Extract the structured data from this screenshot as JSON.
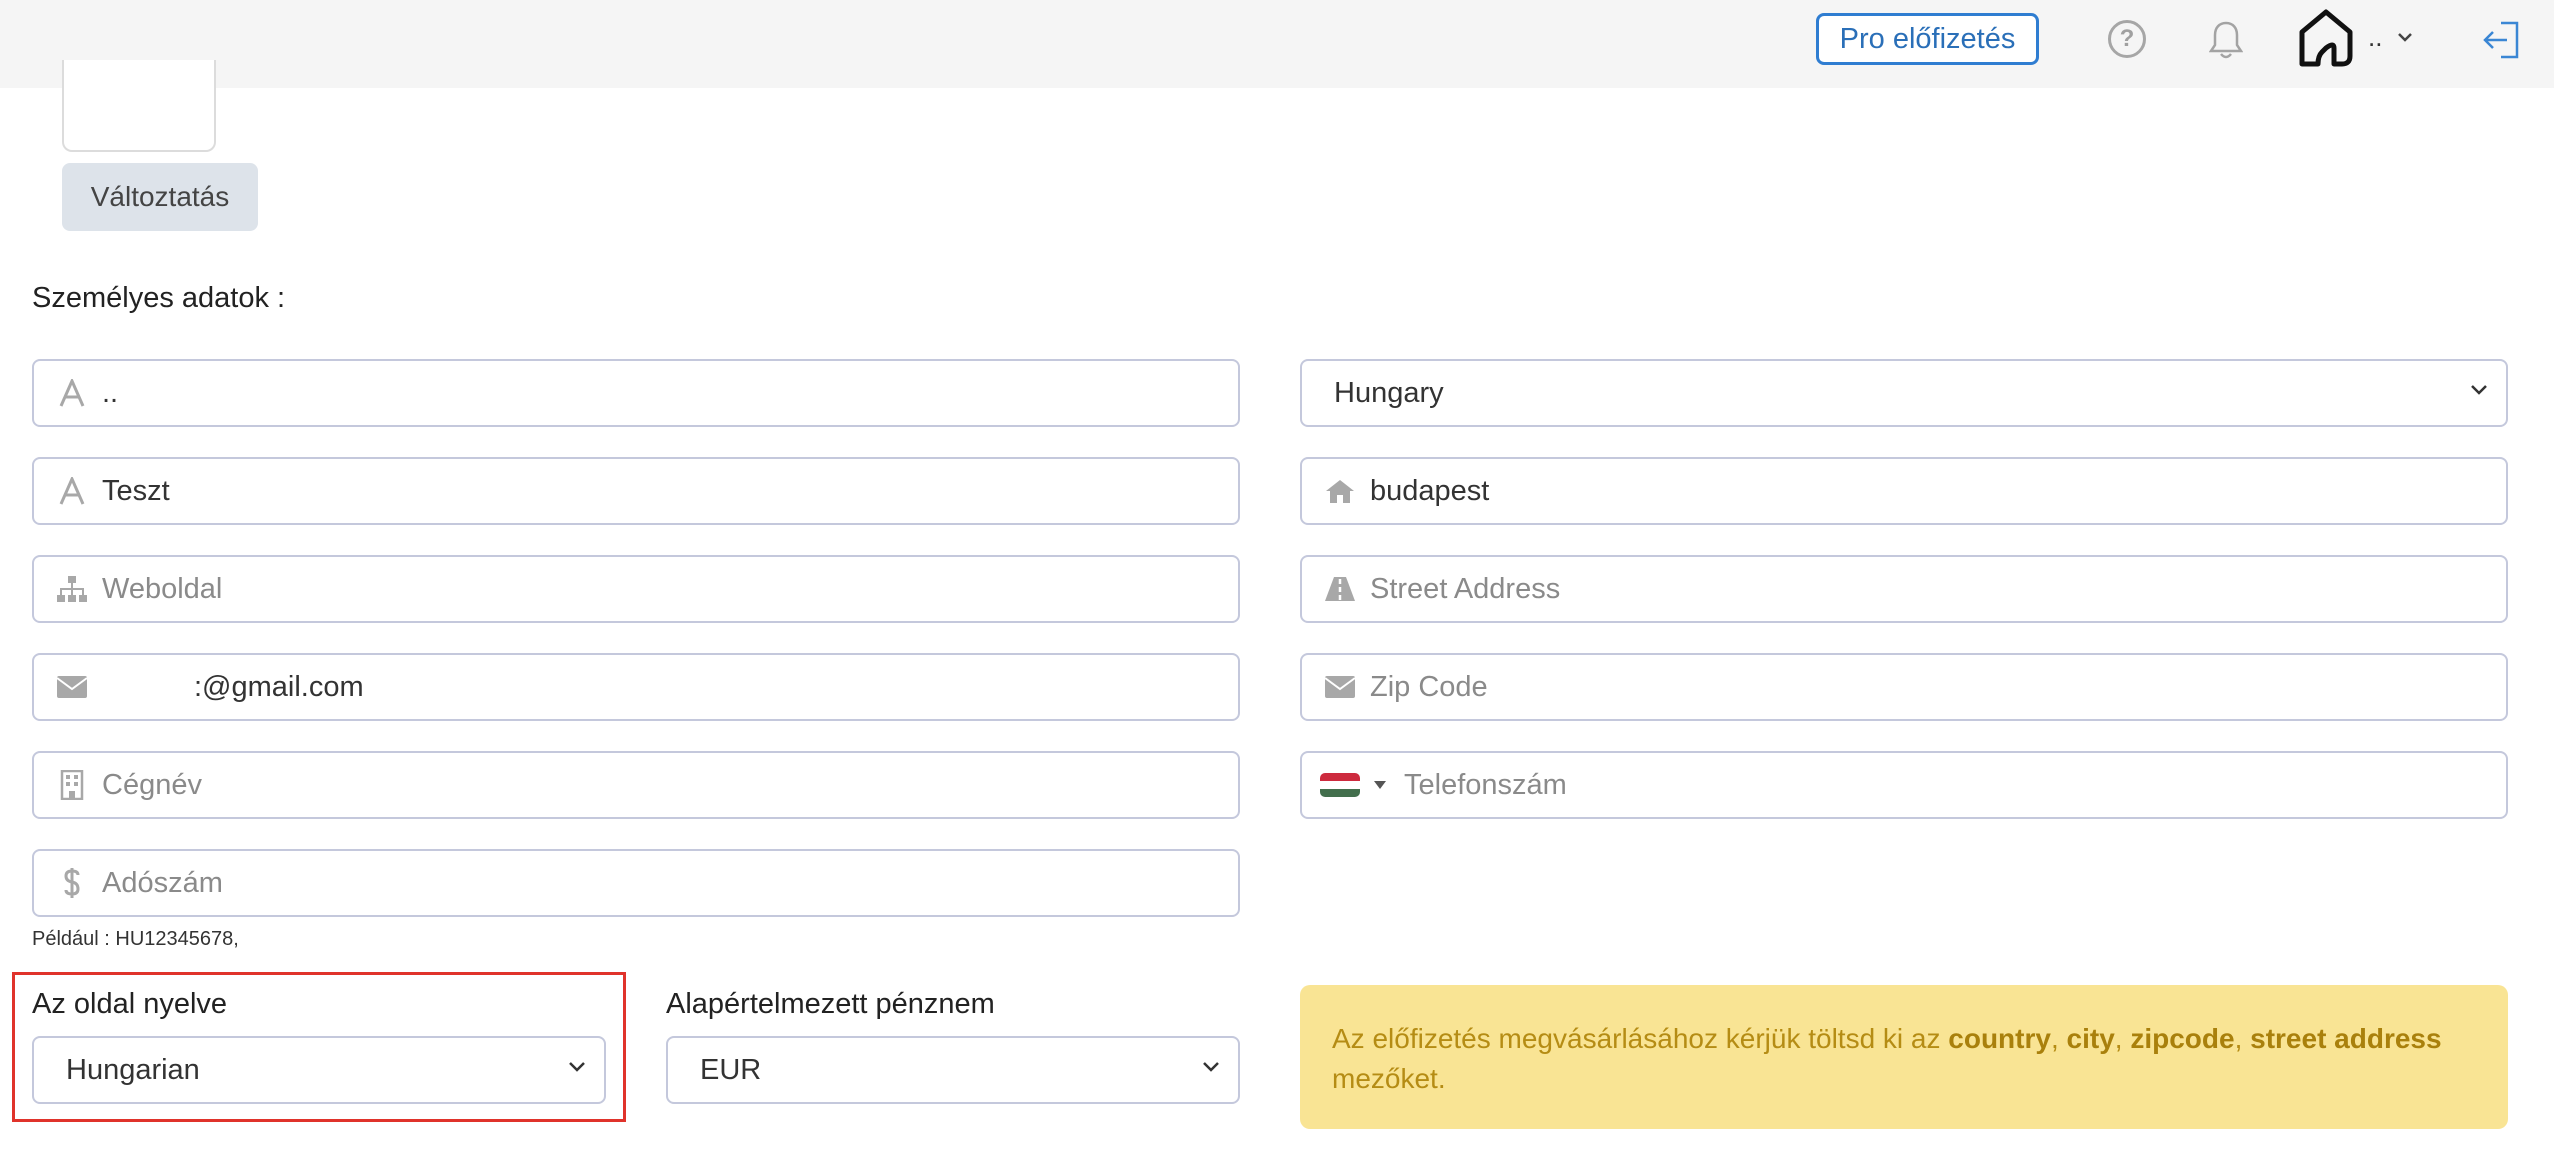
{
  "header": {
    "pro_button": "Pro előfizetés",
    "help_glyph": "?",
    "user_name": "..",
    "icons": [
      "help-icon",
      "bell-icon",
      "home-logo-icon",
      "chevron-down-icon",
      "logout-icon"
    ]
  },
  "avatar": {
    "change_button": "Változtatás"
  },
  "personal": {
    "title": "Személyes adatok :",
    "first_name": {
      "value": "..",
      "icon": "font-icon"
    },
    "last_name": {
      "value": "Teszt",
      "icon": "font-icon"
    },
    "website": {
      "placeholder": "Weboldal",
      "icon": "sitemap-icon"
    },
    "email": {
      "value": ":@gmail.com",
      "icon": "envelope-icon"
    },
    "company": {
      "placeholder": "Cégnév",
      "icon": "building-icon"
    },
    "tax_number": {
      "placeholder": "Adószám",
      "icon": "dollar-icon"
    },
    "tax_hint": "Például : HU12345678,",
    "country": {
      "value": "Hungary"
    },
    "city": {
      "value": "budapest",
      "icon": "home-icon"
    },
    "street": {
      "placeholder": "Street Address",
      "icon": "road-icon"
    },
    "zip": {
      "placeholder": "Zip Code",
      "icon": "envelope-icon"
    },
    "phone": {
      "placeholder": "Telefonszám",
      "flag_colors": [
        "#cd2a3e",
        "#ffffff",
        "#436f4d"
      ]
    }
  },
  "settings": {
    "language_label": "Az oldal nyelve",
    "language_value": "Hungarian",
    "currency_label": "Alapértelmezett pénznem",
    "currency_value": "EUR"
  },
  "alert": {
    "prefix": "Az előfizetés megvásárlásához kérjük töltsd ki az ",
    "country": "country",
    "sep1": ", ",
    "city": "city",
    "sep2": ", ",
    "zipcode": "zipcode",
    "sep3": ", ",
    "street": "street address",
    "suffix": " mezőket."
  },
  "colors": {
    "accent": "#2f7dd1",
    "alert_bg": "#f9e494",
    "alert_text": "#b58c14",
    "highlight": "#e0332b"
  }
}
